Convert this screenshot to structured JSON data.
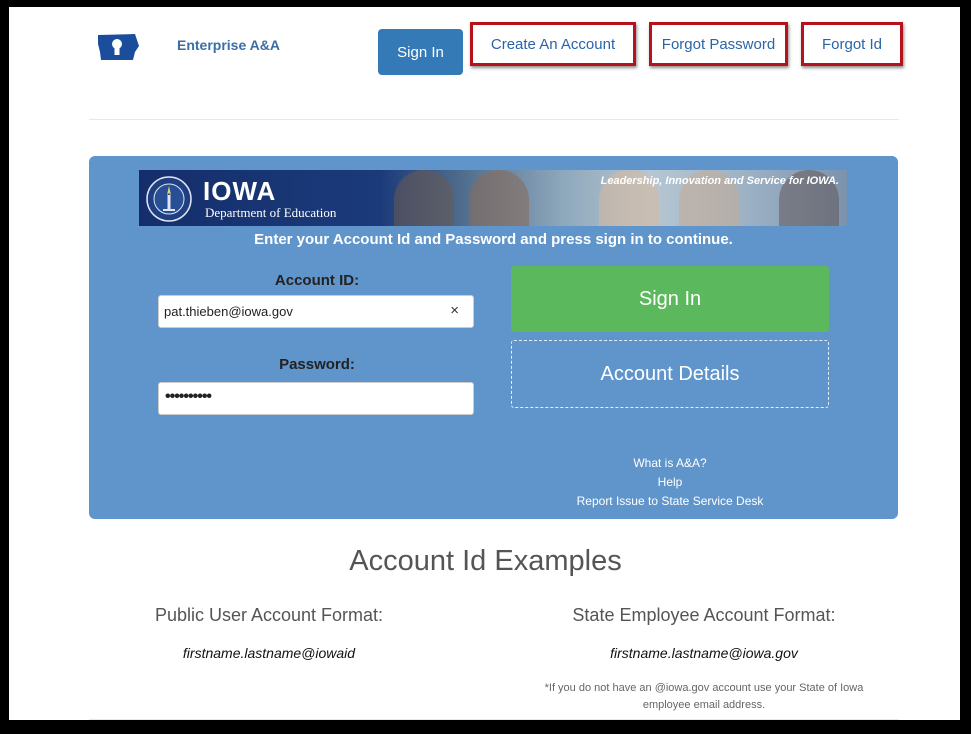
{
  "header": {
    "app_title": "Enterprise A&A",
    "nav": {
      "sign_in": "Sign In",
      "create_account": "Create An Account",
      "forgot_password": "Forgot Password",
      "forgot_id": "Forgot Id"
    }
  },
  "banner": {
    "state": "IOWA",
    "department": "Department of Education",
    "tagline": "Leadership, Innovation and Service for IOWA."
  },
  "form": {
    "instruction": "Enter your Account Id and Password and press sign in to continue.",
    "account_id_label": "Account ID:",
    "account_id_value": "pat.thieben@iowa.gov",
    "clear_icon": "×",
    "password_label": "Password:",
    "password_value": "••••••••••",
    "sign_in_button": "Sign In",
    "account_details_button": "Account Details"
  },
  "links": {
    "what_is": "What is A&A?",
    "help": "Help",
    "report": "Report Issue to State Service Desk"
  },
  "examples": {
    "title": "Account Id Examples",
    "public_heading": "Public User Account Format:",
    "public_example": "firstname.lastname@iowaid",
    "state_heading": "State Employee Account Format:",
    "state_example": "firstname.lastname@iowa.gov",
    "footnote": "*If you do not have an @iowa.gov account use your State of Iowa employee email address."
  },
  "colors": {
    "panel": "#5f95cb",
    "primary_button": "#337ab7",
    "success_button": "#5cb85c",
    "highlight_border": "#b5121b"
  }
}
